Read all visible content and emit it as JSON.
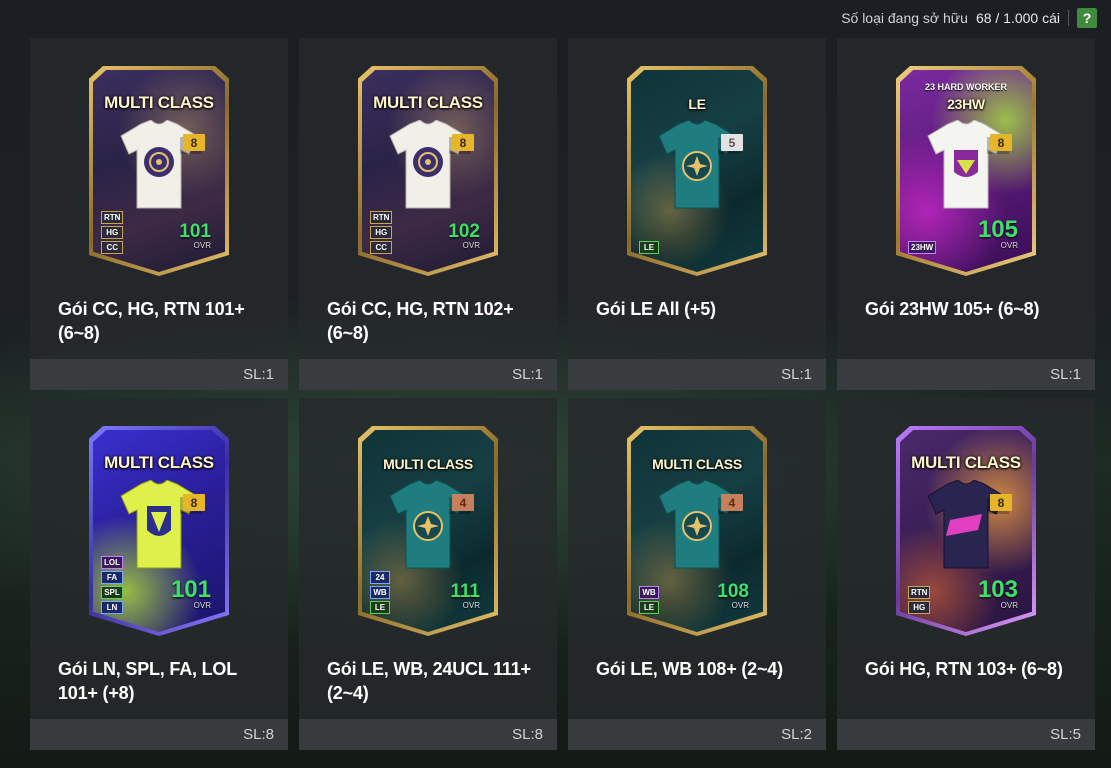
{
  "header": {
    "label": "Số loại đang sở hữu",
    "count": "68 / 1.000 cái",
    "help": "?"
  },
  "packs": [
    {
      "card_title": "MULTI CLASS",
      "card_sub": "",
      "level": "8",
      "tags": [
        "RTN",
        "HG",
        "CC"
      ],
      "ovr": "101",
      "ovr_label": "OVR",
      "name": "Gói CC, HG, RTN 101+ (6~8)",
      "qty": "SL:1"
    },
    {
      "card_title": "MULTI CLASS",
      "card_sub": "",
      "level": "8",
      "tags": [
        "RTN",
        "HG",
        "CC"
      ],
      "ovr": "102",
      "ovr_label": "OVR",
      "name": "Gói CC, HG, RTN 102+ (6~8)",
      "qty": "SL:1"
    },
    {
      "card_title": "LE",
      "card_sub": "",
      "level": "5",
      "tags": [
        "LE"
      ],
      "ovr": "",
      "ovr_label": "",
      "name": "Gói LE All (+5)",
      "qty": "SL:1"
    },
    {
      "card_title": "23HW",
      "card_sub": "23 HARD WORKER",
      "level": "8",
      "tags": [
        "23HW"
      ],
      "ovr": "105",
      "ovr_label": "OVR",
      "name": "Gói 23HW 105+ (6~8)",
      "qty": "SL:1"
    },
    {
      "card_title": "MULTI CLASS",
      "card_sub": "",
      "level": "8",
      "tags": [
        "LOL",
        "FA",
        "SPL",
        "LN"
      ],
      "ovr": "101",
      "ovr_label": "OVR",
      "name": "Gói LN, SPL, FA, LOL 101+ (+8)",
      "qty": "SL:8"
    },
    {
      "card_title": "MULTI CLASS",
      "card_sub": "",
      "level": "4",
      "tags": [
        "24",
        "WB",
        "LE"
      ],
      "ovr": "111",
      "ovr_label": "OVR",
      "name": "Gói LE, WB, 24UCL 111+ (2~4)",
      "qty": "SL:8"
    },
    {
      "card_title": "MULTI CLASS",
      "card_sub": "",
      "level": "4",
      "tags": [
        "WB",
        "LE"
      ],
      "ovr": "108",
      "ovr_label": "OVR",
      "name": "Gói LE, WB 108+ (2~4)",
      "qty": "SL:2"
    },
    {
      "card_title": "MULTI CLASS",
      "card_sub": "",
      "level": "8",
      "tags": [
        "RTN",
        "HG"
      ],
      "ovr": "103",
      "ovr_label": "OVR",
      "name": "Gói HG, RTN 103+ (6~8)",
      "qty": "SL:5"
    }
  ],
  "colors": {
    "ovr_green": "#3fe06a",
    "gold_level": "#e6b52a",
    "help_green": "#3f8a3d"
  }
}
